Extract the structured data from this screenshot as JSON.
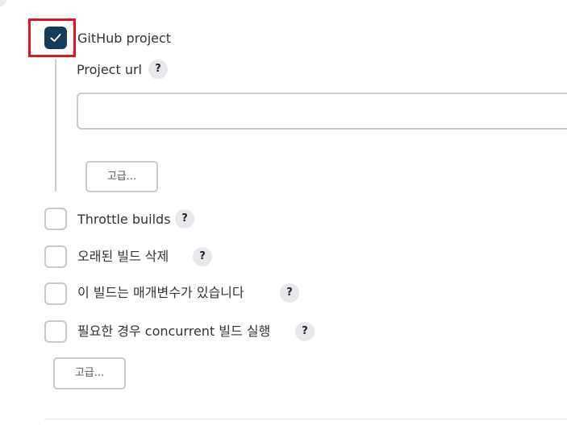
{
  "github_project": {
    "label": "GitHub project",
    "checked": true,
    "project_url_label": "Project url",
    "project_url_value": "",
    "advanced_label": "고급..."
  },
  "options": [
    {
      "label": "Throttle builds",
      "checked": false
    },
    {
      "label": "오래된 빌드 삭제",
      "checked": false
    },
    {
      "label": "이 빌드는 매개변수가 있습니다",
      "checked": false
    },
    {
      "label": "필요한 경우 concurrent 빌드 실행",
      "checked": false
    }
  ],
  "help_glyph": "?",
  "advanced_label": "고급...",
  "colors": {
    "checkbox_checked": "#153b5a",
    "highlight": "#e0141c"
  }
}
